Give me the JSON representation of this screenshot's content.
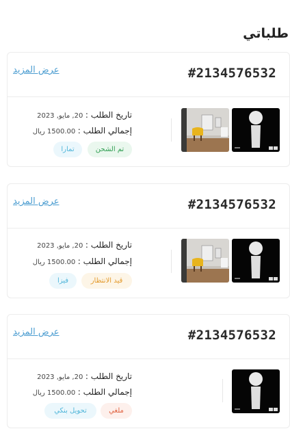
{
  "page": {
    "title": "طلباتي"
  },
  "orders": [
    {
      "number": "#2134576532",
      "more_label": "عرض المزيد",
      "date_label": "تاريخ الطلب :",
      "date_value": "20, مايو, 2023",
      "total_label": "إجمالي الطلب :",
      "total_value": "1500.00 ريال",
      "status_label": "تم الشحن",
      "status_color": "#2f9e51",
      "payment_label": "تمارا",
      "payment_color": "#4fb5d9",
      "images": [
        "lamp-product-icon",
        "room-chair-photo"
      ]
    },
    {
      "number": "#2134576532",
      "more_label": "عرض المزيد",
      "date_label": "تاريخ الطلب :",
      "date_value": "20, مايو, 2023",
      "total_label": "إجمالي الطلب :",
      "total_value": "1500.00 ريال",
      "status_label": "قيد الانتظار",
      "status_color": "#e39a2d",
      "payment_label": "فيزا",
      "payment_color": "#4fb5d9",
      "images": [
        "lamp-product-icon",
        "room-chair-photo"
      ]
    },
    {
      "number": "#2134576532",
      "more_label": "عرض المزيد",
      "date_label": "تاريخ الطلب :",
      "date_value": "20, مايو, 2023",
      "total_label": "إجمالي الطلب :",
      "total_value": "1500.00 ريال",
      "status_label": "ملغي",
      "status_color": "#e0613f",
      "payment_label": "تحويل بنكي",
      "payment_color": "#4fb5d9",
      "images": [
        "lamp-product-icon"
      ]
    }
  ]
}
